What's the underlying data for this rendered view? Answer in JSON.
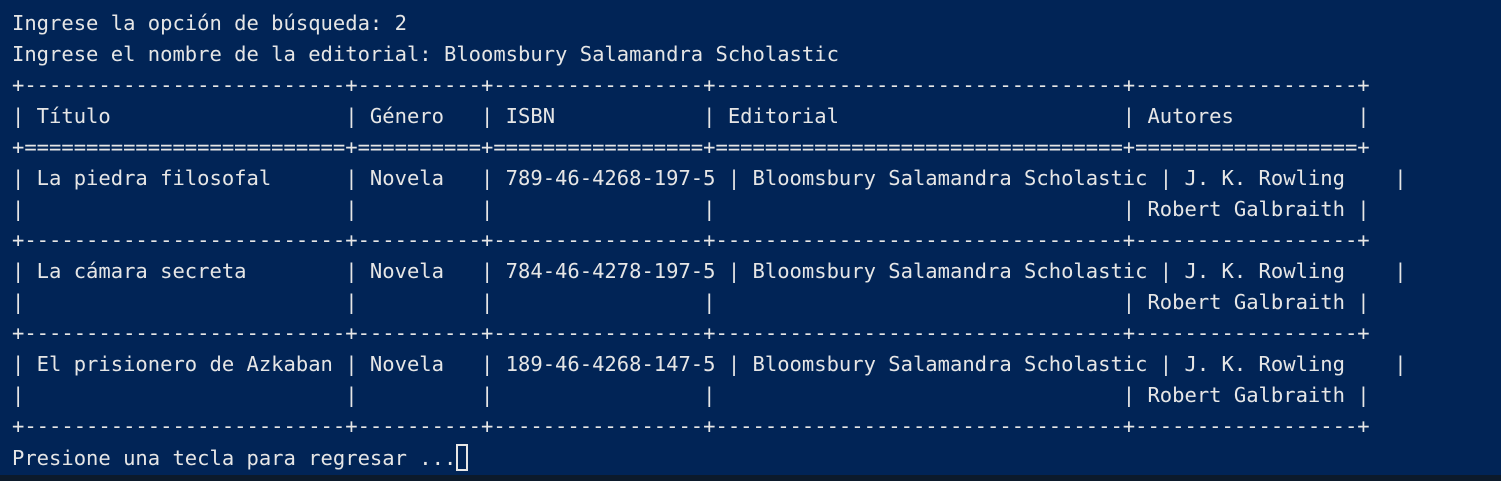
{
  "terminal": {
    "colors": {
      "background": "#012456",
      "foreground": "#e6e6e6"
    },
    "lines": [
      "Ingrese la opción de búsqueda: 2",
      "Ingrese el nombre de la editorial: Bloomsbury Salamandra Scholastic",
      "+--------------------------+----------+-----------------+---------------------------------+------------------+",
      "| Título                   | Género   | ISBN            | Editorial                       | Autores          |",
      "+==========================+==========+=================+=================================+==================+",
      "| La piedra filosofal      | Novela   | 789-46-4268-197-5 | Bloomsbury Salamandra Scholastic | J. K. Rowling    |",
      "|                          |          |                 |                                 | Robert Galbraith |",
      "+--------------------------+----------+-----------------+---------------------------------+------------------+",
      "| La cámara secreta        | Novela   | 784-46-4278-197-5 | Bloomsbury Salamandra Scholastic | J. K. Rowling    |",
      "|                          |          |                 |                                 | Robert Galbraith |",
      "+--------------------------+----------+-----------------+---------------------------------+------------------+",
      "| El prisionero de Azkaban | Novela   | 189-46-4268-147-5 | Bloomsbury Salamandra Scholastic | J. K. Rowling    |",
      "|                          |          |                 |                                 | Robert Galbraith |",
      "+--------------------------+----------+-----------------+---------------------------------+------------------+",
      "Presione una tecla para regresar ..."
    ]
  }
}
